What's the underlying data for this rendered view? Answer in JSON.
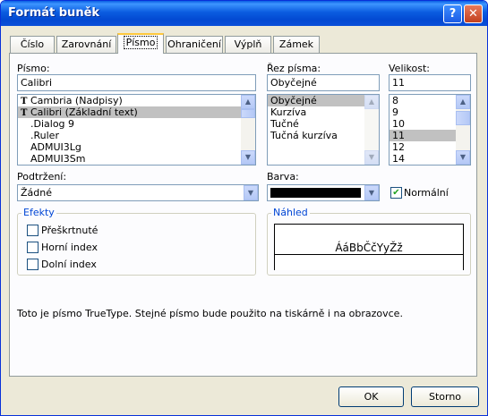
{
  "title": "Formát buněk",
  "titlebar_buttons": {
    "help": "?",
    "close": "✕"
  },
  "tabs": [
    {
      "label": "Číslo"
    },
    {
      "label": "Zarovnání"
    },
    {
      "label": "Písmo",
      "active": true
    },
    {
      "label": "Ohraničení"
    },
    {
      "label": "Výplň"
    },
    {
      "label": "Zámek"
    }
  ],
  "font": {
    "label": "Písmo:",
    "value": "Calibri",
    "list": [
      "Cambria (Nadpisy)",
      "Calibri (Základní text)",
      ".Dialog 9",
      ".Ruler",
      "ADMUI3Lg",
      "ADMUI3Sm"
    ],
    "selected_index": 1
  },
  "style": {
    "label": "Řez písma:",
    "value": "Obyčejné",
    "list": [
      "Obyčejné",
      "Kurzíva",
      "Tučné",
      "Tučná kurzíva"
    ],
    "selected_index": 0
  },
  "size": {
    "label": "Velikost:",
    "value": "11",
    "list": [
      "8",
      "9",
      "10",
      "11",
      "12",
      "14"
    ],
    "selected_index": 3
  },
  "underline": {
    "label": "Podtržení:",
    "value": "Žádné"
  },
  "color": {
    "label": "Barva:",
    "swatch": "#000000",
    "normal_label": "Normální",
    "normal_checked": true
  },
  "effects": {
    "label": "Efekty",
    "items": [
      {
        "label": "Přeškrtnuté",
        "checked": false
      },
      {
        "label": "Horní index",
        "checked": false
      },
      {
        "label": "Dolní index",
        "checked": false
      }
    ]
  },
  "preview": {
    "label": "Náhled",
    "sample": "ÁáBbČčYyŽž"
  },
  "info_text": "Toto je písmo TrueType. Stejné písmo bude použito na tiskárně i na obrazovce.",
  "buttons": {
    "ok": "OK",
    "cancel": "Storno"
  }
}
